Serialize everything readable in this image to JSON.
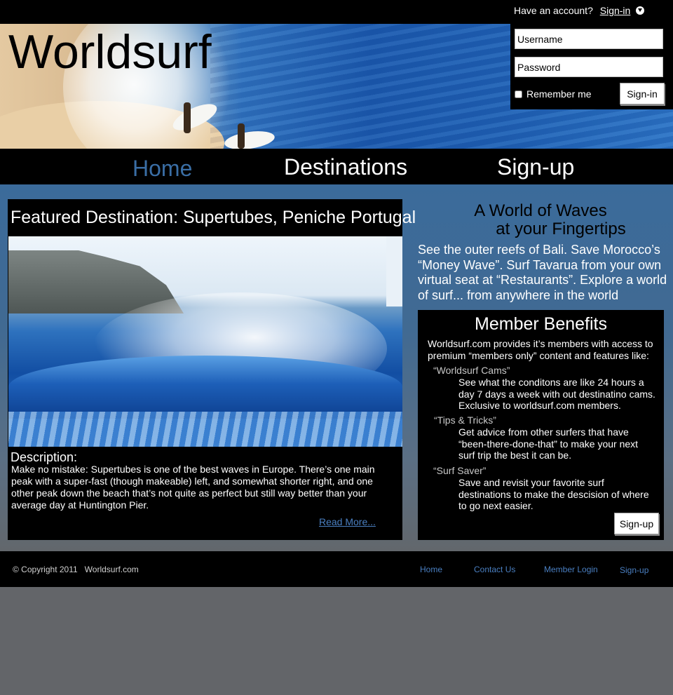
{
  "header": {
    "logo": "Worldsurf",
    "account_prompt": "Have an account?",
    "account_signin_link": "Sign-in"
  },
  "login": {
    "username_placeholder": "Username",
    "password_placeholder": "Password",
    "remember_label": "Remember me",
    "signin_button": "Sign-in"
  },
  "nav": {
    "items": [
      {
        "label": "Home",
        "active": true
      },
      {
        "label": "Destinations",
        "active": false
      },
      {
        "label": "Sign-up",
        "active": false
      }
    ],
    "active_color": "#3a6ea5"
  },
  "featured": {
    "title": "Featured Destination: Supertubes, Peniche Portugal",
    "description_label": "Description:",
    "description": "Make no mistake: Supertubes is one of the best waves in Europe.  There’s one main peak with a super-fast (though makeable) left, and somewhat shorter right, and one other peak down the beach that’s not quite as perfect but still way better than your average day at Huntington Pier.",
    "read_more": "Read More..."
  },
  "aside": {
    "tagline_line1": "A World of Waves",
    "tagline_line2": "at your Fingertips",
    "pitch": "See the outer reefs of Bali. Save Morocco’s “Money Wave”. Surf Tavarua from your own virtual seat at “Restaurants”. Explore a world of surf... from anywhere in the world"
  },
  "benefits": {
    "title": "Member Benefits",
    "intro": "Worldsurf.com provides it’s members with access to premium “members only” content and features like:",
    "items": [
      {
        "name": "“Worldsurf Cams”",
        "desc": "See what the conditons are like 24 hours a day 7 days a week with out destinatino cams. Exclusive to worldsurf.com members."
      },
      {
        "name": "“Tips & Tricks”",
        "desc": "Get advice from other surfers that have “been-there-done-that” to make your next surf trip the best it can be."
      },
      {
        "name": "“Surf Saver”",
        "desc": "Save and revisit your favorite surf destinations to make the descision of where to go next easier."
      }
    ],
    "signup_button": "Sign-up"
  },
  "footer": {
    "copyright": "© Copyright 2011   Worldsurf.com",
    "links": [
      "Home",
      "Contact Us",
      "Member Login",
      "Sign-up"
    ]
  }
}
